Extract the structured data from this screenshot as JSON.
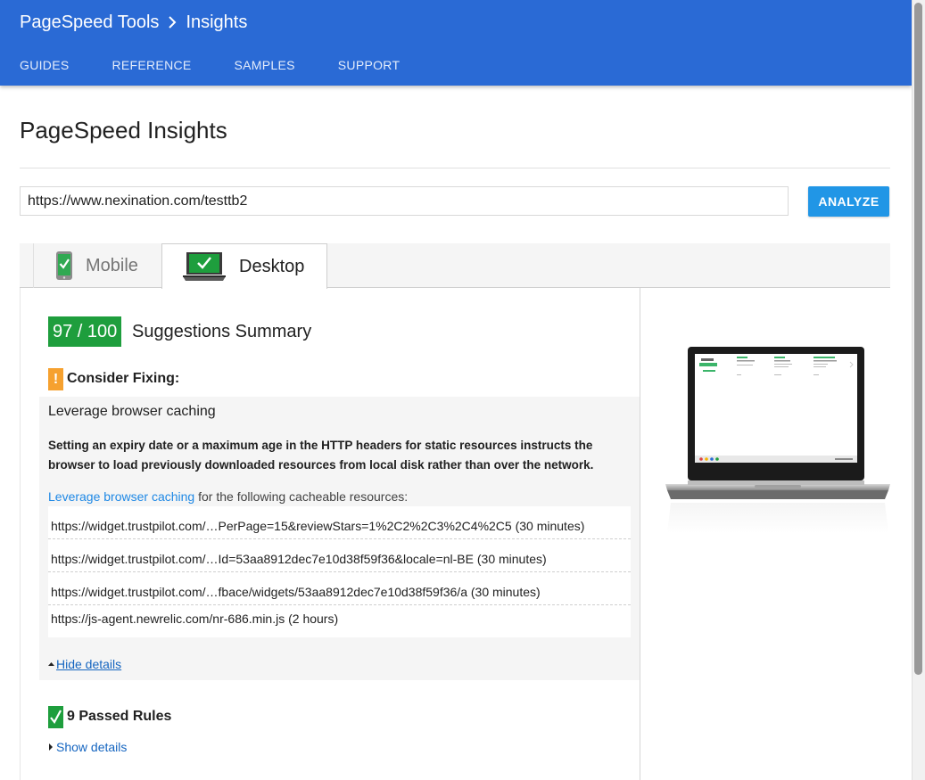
{
  "header": {
    "breadcrumb": [
      "PageSpeed Tools",
      "Insights"
    ],
    "nav": [
      "GUIDES",
      "REFERENCE",
      "SAMPLES",
      "SUPPORT"
    ],
    "color": "#2a6ad5"
  },
  "page": {
    "title": "PageSpeed Insights",
    "url_value": "https://www.nexination.com/testtb2",
    "analyze_label": "ANALYZE"
  },
  "tabs": [
    {
      "label": "Mobile",
      "icon": "phone-check-icon",
      "active": false
    },
    {
      "label": "Desktop",
      "icon": "monitor-check-icon",
      "active": true
    }
  ],
  "results": {
    "score": "97 / 100",
    "summary_title": "Suggestions Summary",
    "consider_icon": "!",
    "consider_label": "Consider Fixing:",
    "rule_name": "Leverage browser caching",
    "rule_description": "Setting an expiry date or a maximum age in the HTTP headers for static resources instructs the browser to load previously downloaded resources from local disk rather than over the network.",
    "cache_link": "Leverage browser caching",
    "cache_suffix": " for the following cacheable resources:",
    "resources": [
      "https://widget.trustpilot.com/…PerPage=15&reviewStars=1%2C2%2C3%2C4%2C5 (30 minutes)",
      "https://widget.trustpilot.com/…Id=53aa8912dec7e10d38f59f36&locale=nl-BE (30 minutes)",
      "https://widget.trustpilot.com/…fbace/widgets/53aa8912dec7e10d38f59f36/a (30 minutes)",
      "https://js-agent.newrelic.com/nr-686.min.js (2 hours)"
    ],
    "hide_details": "Hide details",
    "passed_label": "9 Passed Rules",
    "show_details": "Show details",
    "score_color": "#1e9e3d",
    "warn_color": "#f6a12f"
  }
}
